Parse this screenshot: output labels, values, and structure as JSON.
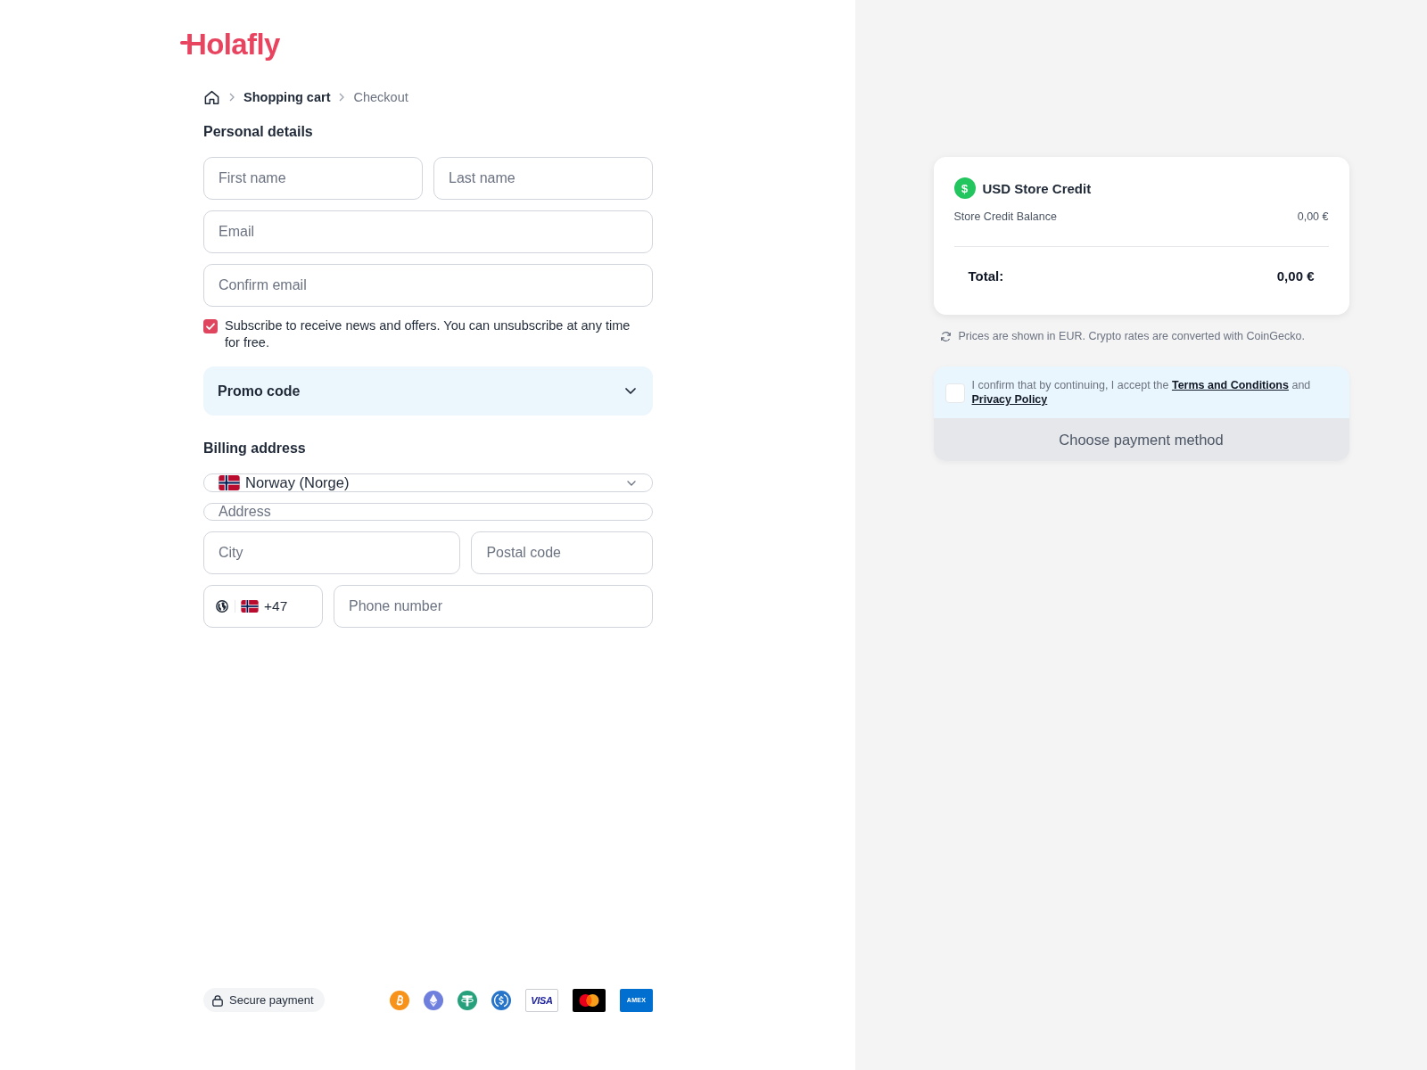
{
  "logo": {
    "text": "Holafly"
  },
  "breadcrumb": {
    "items": [
      {
        "label": "Shopping cart",
        "current": false
      },
      {
        "label": "Checkout",
        "current": true
      }
    ]
  },
  "personal_details": {
    "title": "Personal details",
    "rows": [
      {
        "fields": [
          {
            "placeholder": "First name"
          },
          {
            "placeholder": "Last name"
          }
        ]
      },
      {
        "fields": [
          {
            "placeholder": "Email"
          }
        ]
      },
      {
        "fields": [
          {
            "placeholder": "Confirm email"
          }
        ]
      }
    ]
  },
  "subscribe": {
    "label": "Subscribe to receive news and offers. You can unsubscribe at any time for free.",
    "checked": true
  },
  "promo": {
    "label": "Promo code",
    "expanded": false
  },
  "billing_address": {
    "title": "Billing address",
    "country": {
      "value": "Norway (Norge)"
    },
    "address": {
      "placeholder": "Address"
    },
    "city": {
      "placeholder": "City"
    },
    "postal_code": {
      "placeholder": "Postal code"
    },
    "phone": {
      "prefix": "+47",
      "placeholder": "Phone number"
    }
  },
  "footer": {
    "secure_label": "Secure payment",
    "visa_label": "VISA",
    "amex_label": "AMEX"
  },
  "summary": {
    "currency_symbol": "$",
    "title": "USD Store Credit",
    "balance_label": "Store Credit Balance",
    "balance_value": "0,00 €",
    "total_label": "Total:",
    "total_value": "0,00 €"
  },
  "note": "Prices are shown in EUR. Crypto rates are converted with CoinGecko.",
  "terms": {
    "checked": false,
    "before": "I confirm that by continuing, I accept the",
    "terms_link": "Terms and Conditions",
    "between": "and",
    "privacy_link": "Privacy Policy"
  },
  "pay_button": {
    "label": "Choose payment method",
    "disabled": true
  }
}
